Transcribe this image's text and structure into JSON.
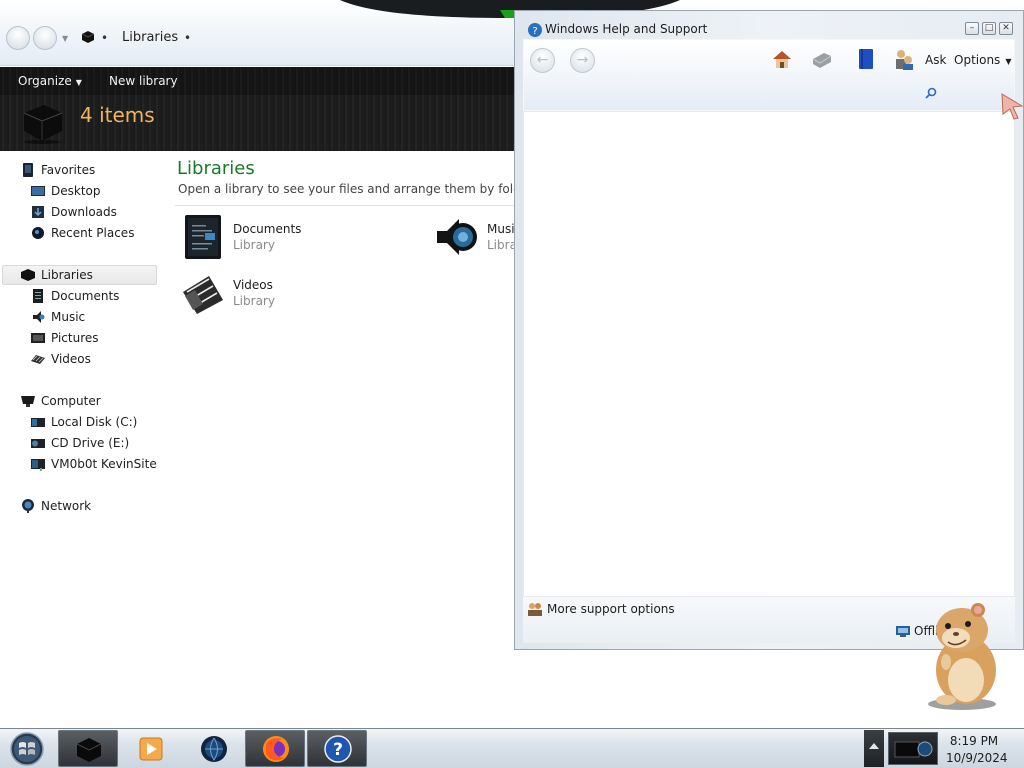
{
  "explorer": {
    "address_path": "Libraries",
    "toolbar": {
      "organize_label": "Organize",
      "new_library_label": "New library"
    },
    "items_count": "4 items",
    "sidebar": {
      "favorites": {
        "label": "Favorites",
        "items": [
          {
            "label": "Desktop",
            "icon": "desktop-icon"
          },
          {
            "label": "Downloads",
            "icon": "downloads-icon"
          },
          {
            "label": "Recent Places",
            "icon": "recent-places-icon"
          }
        ]
      },
      "libraries": {
        "label": "Libraries",
        "items": [
          {
            "label": "Documents",
            "icon": "documents-icon"
          },
          {
            "label": "Music",
            "icon": "music-icon"
          },
          {
            "label": "Pictures",
            "icon": "pictures-icon"
          },
          {
            "label": "Videos",
            "icon": "videos-icon"
          }
        ]
      },
      "computer": {
        "label": "Computer",
        "items": [
          {
            "label": "Local Disk (C:)",
            "icon": "local-disk-icon"
          },
          {
            "label": "CD Drive (E:)",
            "icon": "cd-drive-icon"
          },
          {
            "label": "VM0b0t KevinSite",
            "icon": "network-drive-icon"
          }
        ]
      },
      "network": {
        "label": "Network"
      }
    },
    "content": {
      "title": "Libraries",
      "description": "Open a library to see your files and arrange them by folder, date",
      "libraries": [
        {
          "name": "Documents",
          "type": "Library"
        },
        {
          "name": "Music",
          "type": "Library"
        },
        {
          "name": "Videos",
          "type": "Library"
        }
      ]
    }
  },
  "help_window": {
    "title": "Windows Help and Support",
    "ask_label": "Ask",
    "options_label": "Options",
    "more_support_label": "More support options",
    "offline_label": "Offline"
  },
  "taskbar": {
    "apps": [
      "explorer",
      "media-player",
      "globe",
      "firefox",
      "help-and-support"
    ],
    "clock_time": "8:19 PM",
    "clock_date": "10/9/2024"
  },
  "colors": {
    "content_title": "#1a7a2a",
    "items_count": "#f0b55a",
    "toolbar_dark": "#1e1e1e"
  }
}
